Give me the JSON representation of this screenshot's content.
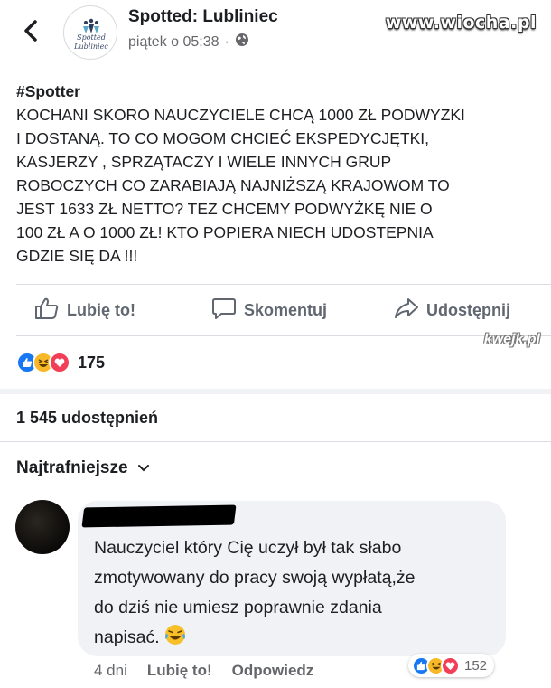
{
  "header": {
    "page_name": "Spotted: Lubliniec",
    "timestamp": "piątek o 05:38",
    "separator": "·",
    "privacy_icon": "globe-icon",
    "avatar_logo_line1": "Spotted",
    "avatar_logo_line2": "Lubliniec",
    "watermark": "www.wiocha.pl"
  },
  "post": {
    "hashtag": "#Spotter",
    "body": "KOCHANI SKORO NAUCZYCIELE CHCĄ 1000 ZŁ PODWYZKI\nI DOSTANĄ.  TO CO MOGOM CHCIEĆ EKSPEDYCJĘTKI,\nKASJERZY , SPRZĄTACZY I WIELE INNYCH GRUP\nROBOCZYCH CO ZARABIAJĄ NAJNIŻSZĄ KRAJOWOM TO\nJEST 1633 ZŁ NETTO? TEZ CHCEMY PODWYŻKĘ  NIE O\n100 ZŁ   A O 1000 ZŁ!  KTO POPIERA NIECH UDOSTEPNIA\nGDZIE SIĘ  DA !!!"
  },
  "actions": {
    "like": "Lubię to!",
    "comment": "Skomentuj",
    "share": "Udostępnij"
  },
  "kwejk_watermark": "kwejk.pl",
  "reactions": {
    "icons": [
      "like-icon",
      "haha-icon",
      "love-icon"
    ],
    "count": "175"
  },
  "shares": "1 545 udostępnień",
  "sort": {
    "label": "Najtrafniejsze"
  },
  "comment": {
    "text": "Nauczyciel który Cię uczył był tak słabo\nzmotywowany do pracy swoją wypłatą,że\ndo dziś nie umiesz poprawnie zdania\nnapisać.",
    "age": "4 dni",
    "like": "Lubię to!",
    "reply": "Odpowiedz",
    "reaction_count": "152"
  },
  "colors": {
    "like_blue": "#1877f2",
    "haha_yellow": "#f7b928",
    "love_red": "#f33e58",
    "meta_gray": "#65676b"
  }
}
